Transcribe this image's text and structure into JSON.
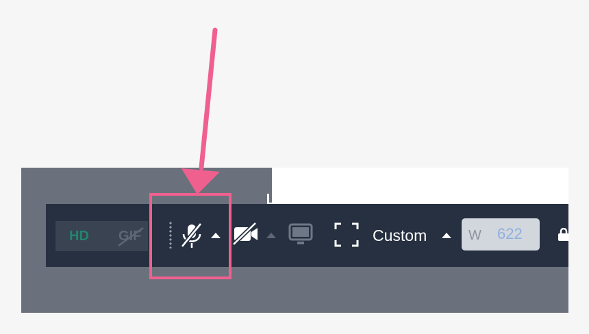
{
  "toolbar": {
    "formats": [
      {
        "label": "HD",
        "active": true
      },
      {
        "label": "GIF",
        "active": false,
        "disabled": true
      }
    ],
    "icons": {
      "microphone": "microphone-muted-icon",
      "camera": "camera-off-icon",
      "screen": "monitor-icon",
      "fullscreen": "fullscreen-icon",
      "lock": "lock-icon"
    },
    "size_preset": "Custom",
    "width_prefix": "W",
    "width_value": "622"
  },
  "annotation": {
    "color": "#f0608f",
    "target": "microphone-muted-icon"
  },
  "colors": {
    "toolbar_bg": "#263040",
    "backdrop": "#6b717c",
    "hd_active": "#21856e",
    "disabled": "#5d6674"
  }
}
